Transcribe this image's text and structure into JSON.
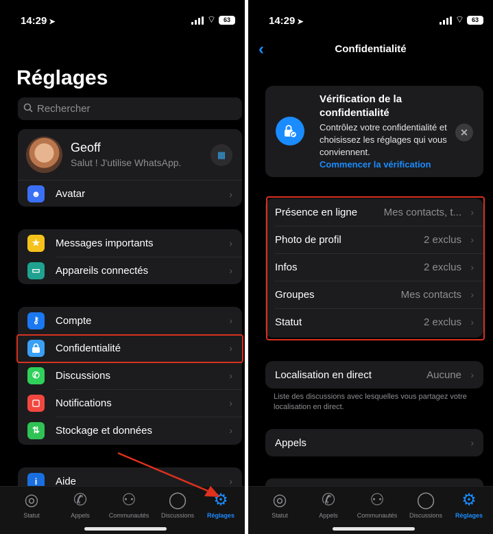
{
  "left": {
    "status": {
      "time": "14:29",
      "battery": "63"
    },
    "title": "Réglages",
    "search_placeholder": "Rechercher",
    "profile": {
      "name": "Geoff",
      "status": "Salut ! J'utilise WhatsApp."
    },
    "avatar_item": "Avatar",
    "group2": [
      "Messages importants",
      "Appareils connectés"
    ],
    "group3": [
      "Compte",
      "Confidentialité",
      "Discussions",
      "Notifications",
      "Stockage et données"
    ],
    "group4": [
      "Aide"
    ],
    "colors": {
      "star": "#f5c21b",
      "devices": "#1fa28f",
      "account": "#1a78f0",
      "privacy": "#3aa0f5",
      "chats": "#2fd15a",
      "notif": "#f2473f",
      "storage": "#30c255",
      "help": "#1a6fe0",
      "avatar": "#3b6ff5"
    }
  },
  "right": {
    "status": {
      "time": "14:29",
      "battery": "63"
    },
    "nav_title": "Confidentialité",
    "card": {
      "title": "Vérification de la confidentialité",
      "text": "Contrôlez votre confidentialité et choisissez les réglages qui vous conviennent.",
      "link": "Commencer la vérification"
    },
    "privacy_rows": [
      {
        "label": "Présence en ligne",
        "value": "Mes contacts, t..."
      },
      {
        "label": "Photo de profil",
        "value": "2 exclus"
      },
      {
        "label": "Infos",
        "value": "2 exclus"
      },
      {
        "label": "Groupes",
        "value": "Mes contacts"
      },
      {
        "label": "Statut",
        "value": "2 exclus"
      }
    ],
    "live_location": {
      "label": "Localisation en direct",
      "value": "Aucune"
    },
    "live_location_note": "Liste des discussions avec lesquelles vous partagez votre localisation en direct.",
    "calls": "Appels"
  },
  "tabs": [
    {
      "label": "Statut",
      "icon": "status-icon"
    },
    {
      "label": "Appels",
      "icon": "phone-icon"
    },
    {
      "label": "Communautés",
      "icon": "communities-icon"
    },
    {
      "label": "Discussions",
      "icon": "chat-bubble-icon"
    },
    {
      "label": "Réglages",
      "icon": "gear-icon"
    }
  ],
  "active_tab": "Réglages",
  "accent": "#1a8cff",
  "highlight_color": "#d8321f"
}
